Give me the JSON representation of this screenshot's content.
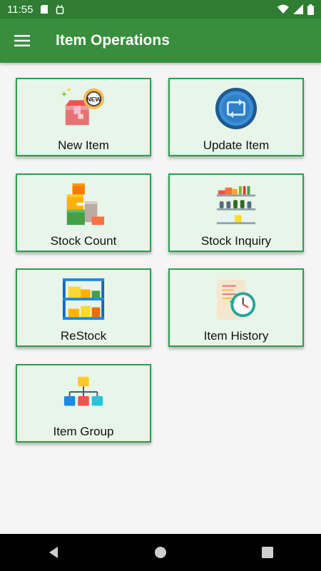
{
  "status_bar": {
    "time": "11:55"
  },
  "app_bar": {
    "title": "Item Operations"
  },
  "tiles": [
    {
      "label": "New Item",
      "icon": "new-item-box-icon"
    },
    {
      "label": "Update Item",
      "icon": "update-refresh-icon"
    },
    {
      "label": "Stock Count",
      "icon": "stock-boxes-icon"
    },
    {
      "label": "Stock Inquiry",
      "icon": "shelves-icon"
    },
    {
      "label": "ReStock",
      "icon": "restock-shelf-icon"
    },
    {
      "label": "Item History",
      "icon": "history-clock-icon"
    },
    {
      "label": "Item Group",
      "icon": "group-hierarchy-icon"
    }
  ],
  "colors": {
    "status_bar": "#2e7d32",
    "app_bar": "#388e3c",
    "tile_bg": "#e8f5e9",
    "tile_border": "#2e9d4f"
  }
}
